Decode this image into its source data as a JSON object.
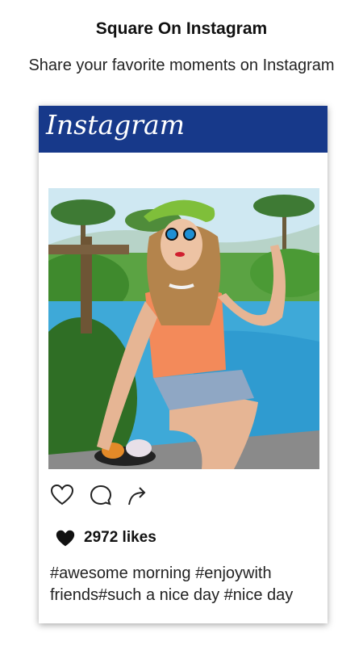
{
  "header": {
    "title": "Square On Instagram",
    "subtitle": "Share your favorite moments on Instagram"
  },
  "card": {
    "brand": "Instagram",
    "brand_color": "#17398a",
    "photo_description": "woman-by-pool-photo",
    "actions": [
      {
        "icon": "heart-outline-icon"
      },
      {
        "icon": "comment-bubble-icon"
      },
      {
        "icon": "share-arrow-icon"
      }
    ],
    "likes_icon": "heart-filled-icon",
    "likes": "2972 likes",
    "caption_line1": "#awesome morning #enjoywith",
    "caption_line2": "friends#such a nice day #nice day"
  }
}
